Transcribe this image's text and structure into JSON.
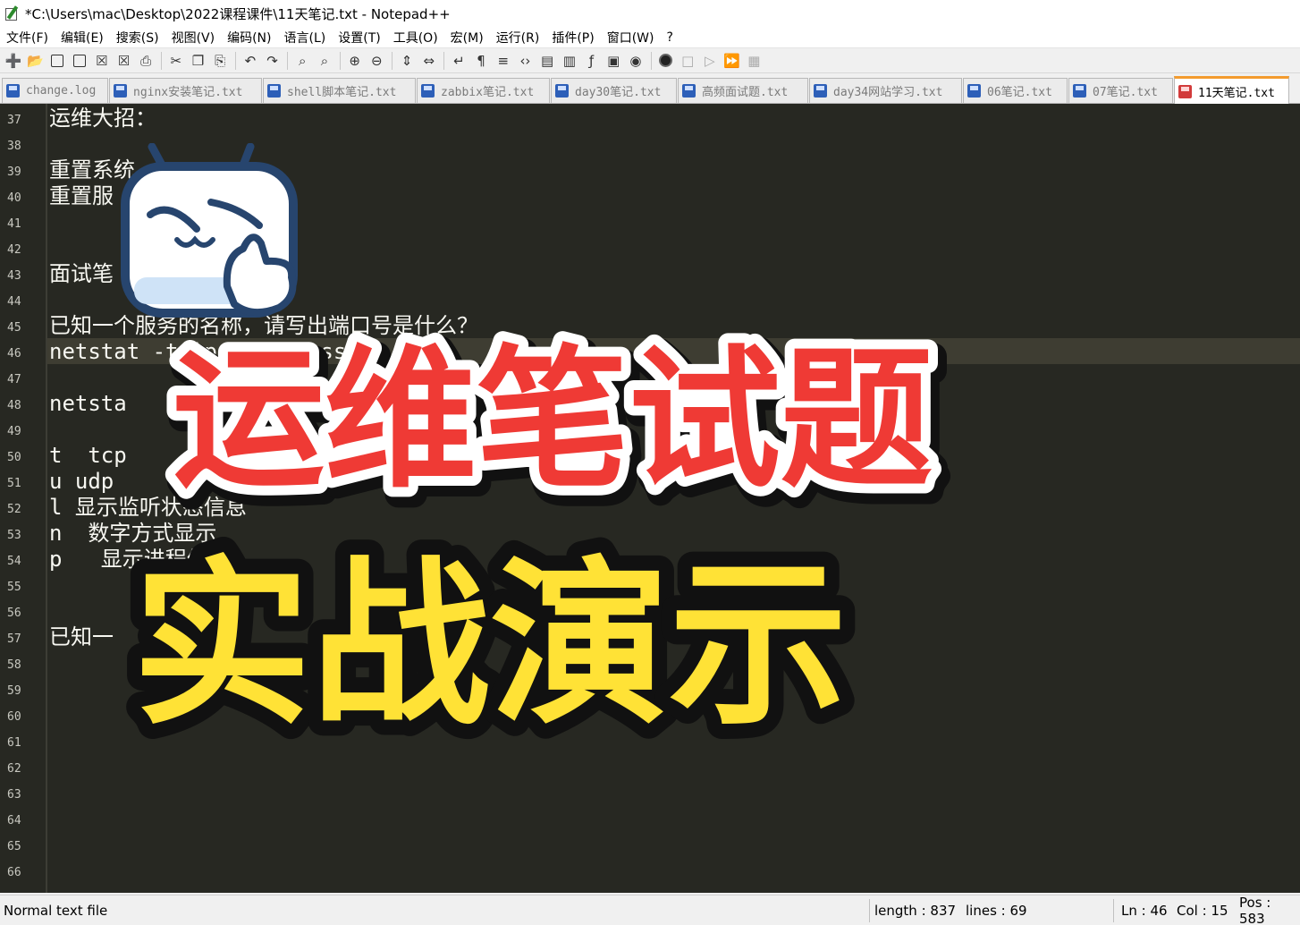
{
  "window": {
    "title": "*C:\\Users\\mac\\Desktop\\2022课程课件\\11天笔记.txt - Notepad++"
  },
  "menu": [
    "文件(F)",
    "编辑(E)",
    "搜索(S)",
    "视图(V)",
    "编码(N)",
    "语言(L)",
    "设置(T)",
    "工具(O)",
    "宏(M)",
    "运行(R)",
    "插件(P)",
    "窗口(W)",
    "?"
  ],
  "toolbar": {
    "icons": [
      "new-file-icon",
      "open-file-icon",
      "save-icon",
      "save-all-icon",
      "close-icon",
      "close-all-icon",
      "print-icon",
      "cut-icon",
      "copy-icon",
      "paste-icon",
      "undo-icon",
      "redo-icon",
      "find-icon",
      "replace-icon",
      "zoom-in-icon",
      "zoom-out-icon",
      "sync-vertical-icon",
      "sync-horizontal-icon",
      "word-wrap-icon",
      "show-all-chars-icon",
      "indent-guide-icon",
      "xml-tag-icon",
      "document-map-icon",
      "document-list-icon",
      "function-list-icon",
      "folder-as-workspace-icon",
      "monitoring-icon",
      "record-macro-icon",
      "stop-record-icon",
      "play-macro-icon",
      "run-macro-multiple-icon",
      "save-macro-icon"
    ]
  },
  "tabs": [
    {
      "label": "change.log",
      "active": false
    },
    {
      "label": "nginx安装笔记.txt",
      "active": false
    },
    {
      "label": "shell脚本笔记.txt",
      "active": false
    },
    {
      "label": "zabbix笔记.txt",
      "active": false
    },
    {
      "label": "day30笔记.txt",
      "active": false
    },
    {
      "label": "高频面试题.txt",
      "active": false
    },
    {
      "label": "day34网站学习.txt",
      "active": false
    },
    {
      "label": "06笔记.txt",
      "active": false
    },
    {
      "label": "07笔记.txt",
      "active": false
    },
    {
      "label": "11天笔记.txt",
      "active": true
    }
  ],
  "editor": {
    "line_numbers": [
      "37",
      "38",
      "39",
      "40",
      "41",
      "42",
      "43",
      "44",
      "45",
      "46",
      "47",
      "48",
      "49",
      "50",
      "51",
      "52",
      "53",
      "54",
      "55",
      "56",
      "57",
      "58",
      "59",
      "60",
      "61",
      "62",
      "63",
      "64",
      "65",
      "66"
    ],
    "current_line": "46",
    "lines": [
      {
        "no": "37",
        "text": "运维大招："
      },
      {
        "no": "39",
        "text": "重置系统"
      },
      {
        "no": "40",
        "text": "重置服"
      },
      {
        "no": "43",
        "text": "面试笔"
      },
      {
        "no": "45",
        "text": "已知一个服务的名称，请写出端口号是什么？"
      },
      {
        "no": "46",
        "text": "netstat -tnlp | grep sshd"
      },
      {
        "no": "48",
        "text": "netsta"
      },
      {
        "no": "50",
        "text": "t  tcp"
      },
      {
        "no": "51",
        "text": "u udp"
      },
      {
        "no": "52",
        "text": "l 显示监听状态信息"
      },
      {
        "no": "53",
        "text": "n  数字方式显示"
      },
      {
        "no": "54",
        "text": "p   显示进程信息"
      },
      {
        "no": "57",
        "text": "已知一              ，i"
      }
    ]
  },
  "overlay": {
    "headline_red": "运维笔试题",
    "headline_yellow": "实战演示",
    "colors": {
      "red": "#ef3a35",
      "yellow": "#ffe236",
      "outline": "#ffffff",
      "shadow": "#111111"
    }
  },
  "status": {
    "file_type": "Normal text file",
    "length": "length : 837",
    "lines": "lines : 69",
    "ln": "Ln : 46",
    "col": "Col : 15",
    "pos": "Pos : 583"
  }
}
